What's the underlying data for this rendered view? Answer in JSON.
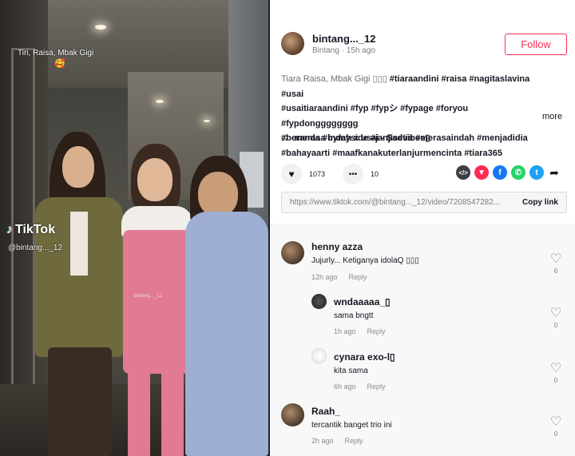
{
  "video": {
    "caption": "Tiri, Raisa, Mbak Gigi",
    "caption_emoji": "🥰",
    "watermark": "TikTok",
    "watermark_handle": "@bintang..._12",
    "shirt_text": "bintang..._12"
  },
  "author": {
    "name": "bintang..._12",
    "subtitle": "Bintang · 15h ago",
    "follow_label": "Follow"
  },
  "description": {
    "lead": "Tiara Raisa, Mbak Gigi ▯▯▯ ",
    "tags_line1": "#tiaraandini #raisa #nagitaslavina #usai",
    "tags_line2": "#usaitiaraandini #fyp #fypシ #fypage #foryou #fypdongggggggg",
    "tags_line3": "#beranda #bymyside #janjisetia #merasaindah #menjadidia",
    "tags_line4": "#bahayaarti #maafkanakuterlanjurmencinta #tiara365",
    "more_label": "more"
  },
  "music": {
    "title": "merasa indah x usai - Sadvibes▯"
  },
  "actions": {
    "likes": "1073",
    "comments": "10"
  },
  "share_colors": {
    "embed": "#3e3e44",
    "friends": "#fe2c55",
    "facebook": "#1877f2",
    "whatsapp": "#25d366",
    "twitter": "#1da1f2"
  },
  "link": {
    "url": "https://www.tiktok.com/@bintang..._12/video/7208547282...",
    "copy_label": "Copy link"
  },
  "comments": [
    {
      "name": "henny azza",
      "text": "Jujurly... Ketiganya idolaQ ▯▯▯",
      "time": "12h ago",
      "reply": "Reply",
      "likes": "6"
    },
    {
      "name": "wndaaaaa_▯",
      "text": "sama bngtt",
      "time": "1h ago",
      "reply": "Reply",
      "likes": "0"
    },
    {
      "name": "cynara exo-l▯",
      "text": "kita sama",
      "time": "6h ago",
      "reply": "Reply",
      "likes": "0"
    },
    {
      "name": "Raah_",
      "text": "tercantik banget trio ini",
      "time": "2h ago",
      "reply": "Reply",
      "likes": "0"
    }
  ]
}
